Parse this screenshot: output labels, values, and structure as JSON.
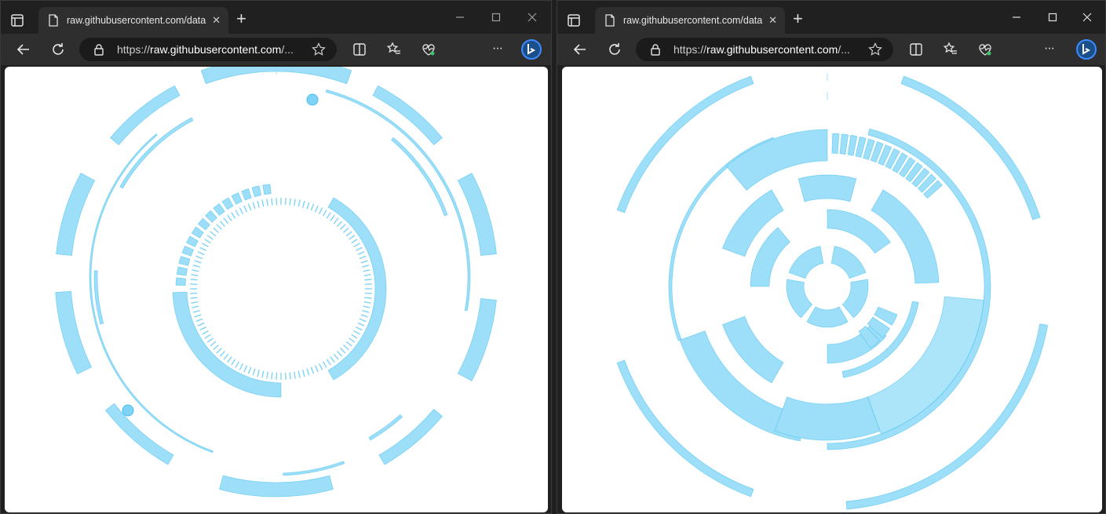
{
  "colors": {
    "hud_fill": "#9ddff9",
    "hud_fill_strong": "#7fd3f7",
    "hud_stroke": "#46bfee",
    "chrome_bg": "#202020",
    "toolbar_bg": "#2e2e2e",
    "addressbar_bg": "#1b1b1b"
  },
  "windows": [
    {
      "tab": {
        "title": "raw.githubusercontent.com/data",
        "close": "✕"
      },
      "newtab": "+",
      "address": {
        "scheme": "https://",
        "host": "raw.githubusercontent.com",
        "rest": "/..."
      },
      "icons": [
        "tab-actions-icon",
        "page-icon",
        "back-arrow-icon",
        "refresh-icon",
        "lock-icon",
        "favorite-star-icon",
        "split-screen-icon",
        "favorites-icon",
        "browser-essentials-icon",
        "more-icon",
        "copilot-icon",
        "minimize-icon",
        "maximize-icon",
        "close-icon"
      ]
    },
    {
      "tab": {
        "title": "raw.githubusercontent.com/data",
        "close": "✕"
      },
      "newtab": "+",
      "address": {
        "scheme": "https://",
        "host": "raw.githubusercontent.com",
        "rest": "/..."
      },
      "icons": [
        "tab-actions-icon",
        "page-icon",
        "back-arrow-icon",
        "refresh-icon",
        "lock-icon",
        "favorite-star-icon",
        "split-screen-icon",
        "favorites-icon",
        "browser-essentials-icon",
        "more-icon",
        "copilot-icon",
        "minimize-icon",
        "maximize-icon",
        "close-icon"
      ]
    }
  ],
  "toolbar": {
    "more_label": "···"
  }
}
